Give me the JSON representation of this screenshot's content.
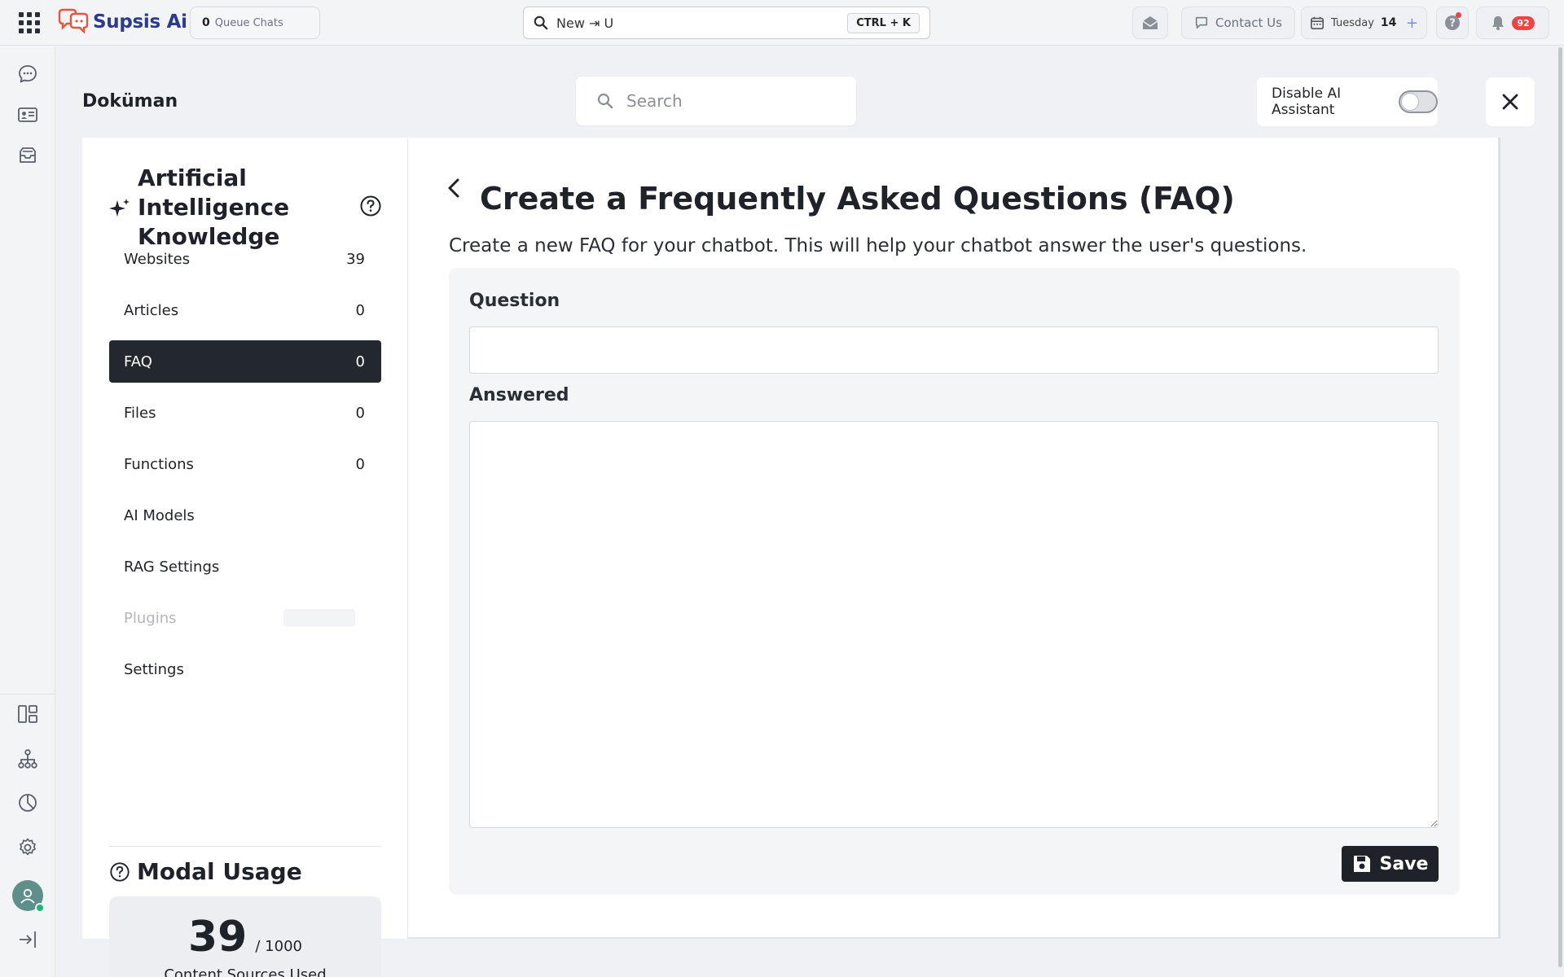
{
  "header": {
    "logo_text": "Supsis Ai",
    "queue": {
      "count": "0",
      "label": "Queue Chats"
    },
    "search": {
      "value": "New ⇥ U",
      "shortcut": "CTRL + K"
    },
    "contact_label": "Contact Us",
    "date": {
      "day": "Tuesday",
      "num": "14"
    },
    "notification_count": "92"
  },
  "page": {
    "title": "Doküman",
    "search_placeholder": "Search",
    "ai_assistant_label": "Disable AI Assistant",
    "ai_assistant_enabled": false
  },
  "knowledge": {
    "title": "Artificial Intelligence Knowledge",
    "items": [
      {
        "label": "Websites",
        "count": "39"
      },
      {
        "label": "Articles",
        "count": "0"
      },
      {
        "label": "FAQ",
        "count": "0",
        "active": true
      },
      {
        "label": "Files",
        "count": "0"
      },
      {
        "label": "Functions",
        "count": "0"
      },
      {
        "label": "AI Models",
        "count": ""
      },
      {
        "label": "RAG Settings",
        "count": ""
      },
      {
        "label": "Plugins",
        "count": "",
        "disabled": true
      },
      {
        "label": "Settings",
        "count": ""
      }
    ],
    "usage": {
      "title": "Modal Usage",
      "used": "39",
      "total": "/ 1000",
      "caption": "Content Sources Used"
    }
  },
  "faq": {
    "title": "Create a Frequently Asked Questions (FAQ)",
    "subtitle": "Create a new FAQ for your chatbot. This will help your chatbot answer the user's questions.",
    "question_label": "Question",
    "question_value": "",
    "answer_label": "Answered",
    "answer_value": "",
    "save_label": "Save"
  },
  "colors": {
    "brand": "#2d3b8f",
    "logo_accent": "#e8553f",
    "active_nav": "#23272e",
    "badge": "#ef4444",
    "online": "#1fb57a"
  },
  "icons": {
    "rail_top": [
      "chat-icon",
      "contact-card-icon",
      "inbox-icon"
    ],
    "rail_bottom": [
      "layout-icon",
      "flow-icon",
      "reports-icon",
      "settings-icon",
      "avatar",
      "logout-icon"
    ]
  }
}
